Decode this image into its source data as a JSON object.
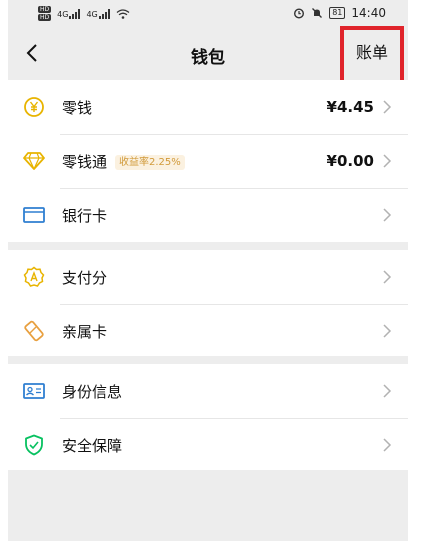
{
  "status_bar": {
    "network_left": "4G",
    "network_right": "4G",
    "battery": "81",
    "time": "14:40"
  },
  "nav": {
    "title": "钱包",
    "bill_label": "账单"
  },
  "groups": [
    {
      "items": [
        {
          "label": "零钱",
          "value": "¥4.45",
          "icon": "yen-coin-icon"
        },
        {
          "label": "零钱通",
          "badge": "收益率2.25%",
          "value": "¥0.00",
          "icon": "diamond-icon"
        },
        {
          "label": "银行卡",
          "icon": "bank-card-icon"
        }
      ]
    },
    {
      "items": [
        {
          "label": "支付分",
          "icon": "score-badge-icon"
        },
        {
          "label": "亲属卡",
          "icon": "family-card-icon"
        }
      ]
    },
    {
      "items": [
        {
          "label": "身份信息",
          "icon": "id-card-icon"
        },
        {
          "label": "安全保障",
          "icon": "shield-check-icon"
        }
      ]
    }
  ],
  "colors": {
    "accent_gold": "#e8b400",
    "accent_blue": "#2f7fd1",
    "accent_green": "#07c160",
    "highlight_red": "#e0242b"
  }
}
